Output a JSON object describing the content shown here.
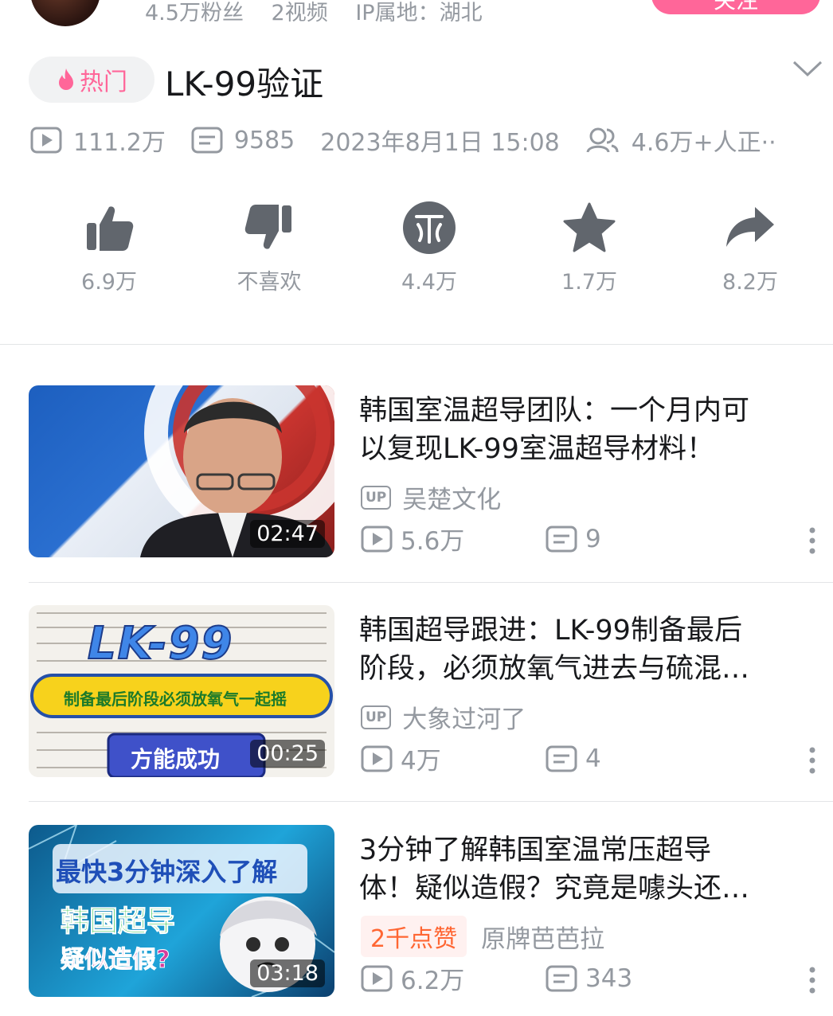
{
  "author": {
    "fans": "4.5万粉丝",
    "videos": "2视频",
    "ip": "IP属地：湖北",
    "follow_label": "关注"
  },
  "video": {
    "hot_tag": "热门",
    "title": "LK-99验证",
    "plays": "111.2万",
    "danmaku": "9585",
    "publish_time": "2023年8月1日 15:08",
    "watching": "4.6万+人正··"
  },
  "actions": [
    {
      "name": "like",
      "label": "6.9万"
    },
    {
      "name": "dislike",
      "label": "不喜欢"
    },
    {
      "name": "coin",
      "label": "4.4万"
    },
    {
      "name": "favorite",
      "label": "1.7万"
    },
    {
      "name": "share",
      "label": "8.2万"
    }
  ],
  "recommendations": [
    {
      "title_line1": "韩国室温超导团队：一个月内可",
      "title_line2": "以复现LK-99室温超导材料！",
      "uploader": "吴楚文化",
      "plays": "5.6万",
      "danmaku": "9",
      "duration": "02:47"
    },
    {
      "title_line1": "韩国超导跟进：LK-99制备最后",
      "title_line2": "阶段，必须放氧气进去与硫混…",
      "uploader": "大象过河了",
      "plays": "4万",
      "danmaku": "4",
      "duration": "00:25",
      "thumb_text": {
        "big": "LK-99",
        "banner": "制备最后阶段必须放氧气一起摇",
        "button": "方能成功"
      }
    },
    {
      "title_line1": "3分钟了解韩国室温常压超导",
      "title_line2": "体！疑似造假？究竟是噱头还…",
      "like_badge": "2千点赞",
      "uploader": "原牌芭芭拉",
      "plays": "6.2万",
      "danmaku": "343",
      "duration": "03:18",
      "thumb_text": {
        "line1": "最快3分钟深入了解",
        "line2": "韩国超导",
        "line3": "疑似造假?"
      }
    }
  ],
  "colors": {
    "accent": "#ff6699",
    "muted": "#9499a0",
    "icon": "#61666d"
  }
}
